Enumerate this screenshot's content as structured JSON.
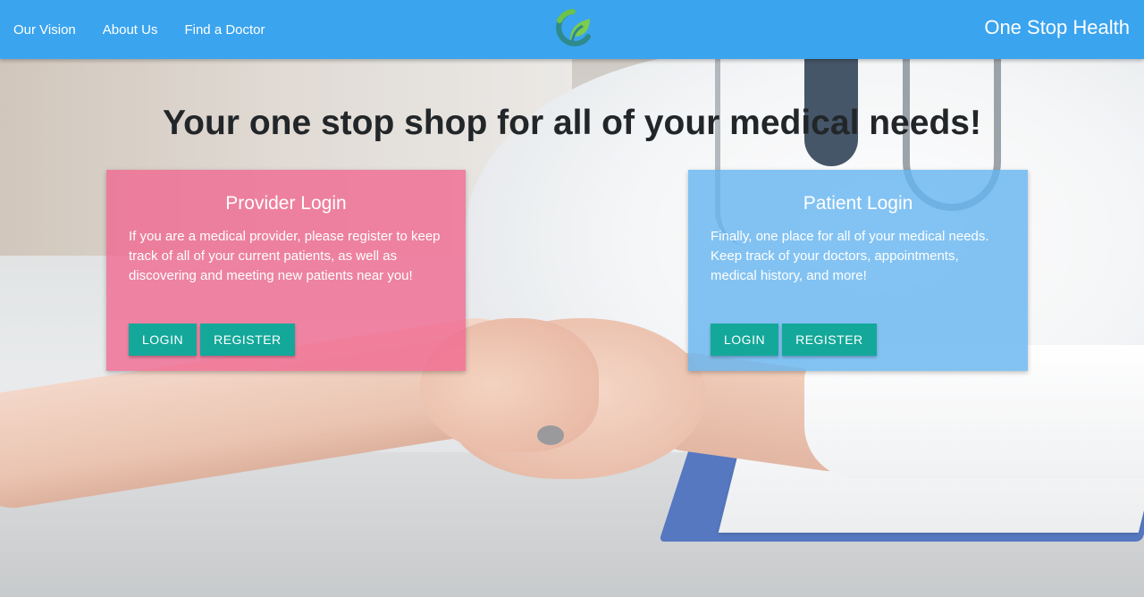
{
  "nav": {
    "links": [
      "Our Vision",
      "About Us",
      "Find a Doctor"
    ],
    "brand": "One Stop Health"
  },
  "hero": {
    "headline": "Your one stop shop for all of your medical needs!"
  },
  "provider_card": {
    "title": "Provider Login",
    "text": "If you are a medical provider, please register to keep track of all of your current patients, as well as discovering and meeting new patients near you!",
    "login_label": "LOGIN",
    "register_label": "REGISTER"
  },
  "patient_card": {
    "title": "Patient Login",
    "text": "Finally, one place for all of your medical needs. Keep track of your doctors, appointments, medical history, and more!",
    "login_label": "LOGIN",
    "register_label": "REGISTER"
  },
  "colors": {
    "navbar": "#3aa4ef",
    "provider_card": "#f06991",
    "patient_card": "#64b4f0",
    "button": "#14a89a"
  },
  "icons": {
    "logo": "leaf-circle-logo-icon"
  }
}
